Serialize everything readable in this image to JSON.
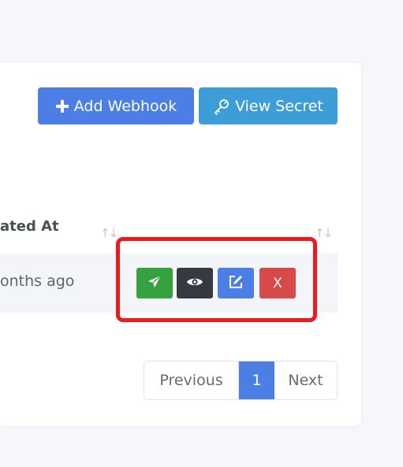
{
  "toolbar": {
    "add_label": "Add Webhook",
    "secret_label": "View Secret"
  },
  "table": {
    "column_header": "ated At",
    "row_text": "onths ago"
  },
  "actions": {
    "delete_label": "X"
  },
  "pagination": {
    "previous": "Previous",
    "current": "1",
    "next": "Next"
  },
  "colors": {
    "primary": "#4c7fe6",
    "info": "#3d9dd6",
    "success": "#35a23f",
    "dark": "#363a40",
    "danger": "#d84a4a",
    "highlight": "#f01818"
  },
  "icons": [
    "plus-icon",
    "key-icon",
    "sort-icon",
    "send-icon",
    "eye-icon",
    "edit-icon"
  ]
}
